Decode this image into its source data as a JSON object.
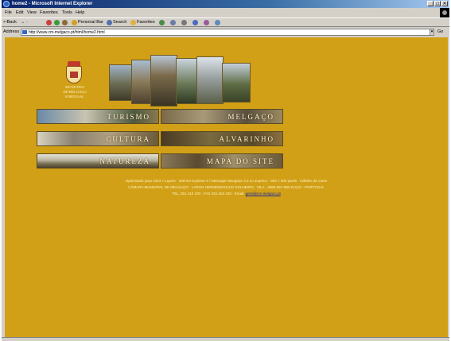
{
  "window": {
    "title": "home2 - Microsoft Internet Explorer",
    "controls": [
      "_",
      "□",
      "✕"
    ]
  },
  "menubar": [
    "File",
    "Edit",
    "View",
    "Favorites",
    "Tools",
    "Help"
  ],
  "toolbar": {
    "back": "⇦Back",
    "search": "Search",
    "personal_bar": "Personal Bar",
    "favorites": "Favorites"
  },
  "address": {
    "label": "Address",
    "url": "http://www.cm-melgaco.pt/html/home2.html",
    "go": "Go"
  },
  "page": {
    "crest_text": [
      "MUNICÍPIO",
      "DE MELGAÇO",
      "PORTUGAL"
    ],
    "menu_buttons": [
      {
        "label": "TURISMO"
      },
      {
        "label": "MELGAÇO"
      },
      {
        "label": "CULTURA"
      },
      {
        "label": "ALVARINHO"
      },
      {
        "label": "NATUREZA"
      },
      {
        "label": "MAPA DO SITE"
      }
    ],
    "footer": {
      "line1": "Optimizado para 1024 × Layers · Internet Explorer 5 / Netscape Navigator 4.0 ou superior · 800 × 600 pixels · milhões de cores",
      "line2": "CÂMARA MUNICIPAL DE MELGAÇO · LARGO HERMENEGILDO SOLHEIRO · VILA · 4960-557 MELGAÇO · PORTUGAL",
      "line3": "TEL. 251 410 100 · FAX 251 404 425 · Email:",
      "email": "geral@cm-melgaco.pt"
    },
    "colors": {
      "background": "#d1a017",
      "text": "#fff3c2",
      "link": "#1a2a9a"
    }
  }
}
